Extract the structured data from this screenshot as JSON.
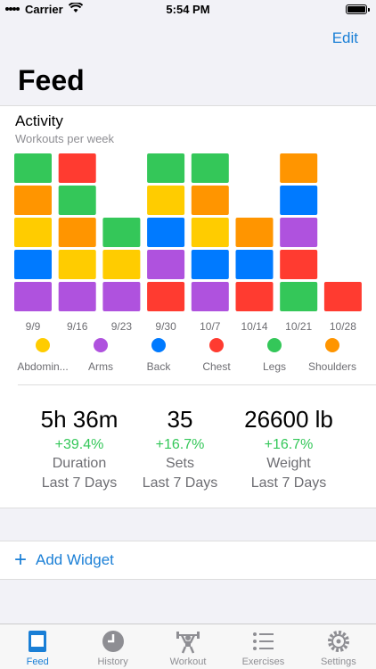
{
  "status": {
    "carrier": "Carrier",
    "time": "5:54 PM"
  },
  "nav": {
    "edit_label": "Edit",
    "title": "Feed"
  },
  "activity": {
    "title": "Activity",
    "subtitle": "Workouts per week"
  },
  "chart_data": {
    "type": "bar",
    "stacked": true,
    "categories": [
      "9/9",
      "9/16",
      "9/23",
      "9/30",
      "10/7",
      "10/14",
      "10/21",
      "10/28"
    ],
    "stacks": [
      [
        "Arms",
        "Back",
        "Abdominals",
        "Shoulders",
        "Legs"
      ],
      [
        "Arms",
        "Abdominals",
        "Shoulders",
        "Legs",
        "Chest"
      ],
      [
        "Arms",
        "Abdominals",
        "Legs"
      ],
      [
        "Chest",
        "Arms",
        "Back",
        "Abdominals",
        "Legs"
      ],
      [
        "Arms",
        "Back",
        "Abdominals",
        "Shoulders",
        "Legs"
      ],
      [
        "Chest",
        "Back",
        "Shoulders"
      ],
      [
        "Legs",
        "Chest",
        "Arms",
        "Back",
        "Shoulders"
      ],
      [
        "Chest"
      ]
    ],
    "legend": [
      {
        "name": "Abdomin...",
        "color": "#ffcc00"
      },
      {
        "name": "Arms",
        "color": "#af52de"
      },
      {
        "name": "Back",
        "color": "#007aff"
      },
      {
        "name": "Chest",
        "color": "#ff3b30"
      },
      {
        "name": "Legs",
        "color": "#34c759"
      },
      {
        "name": "Shoulders",
        "color": "#ff9500"
      }
    ],
    "colors": {
      "Abdominals": "#ffcc00",
      "Arms": "#af52de",
      "Back": "#007aff",
      "Chest": "#ff3b30",
      "Legs": "#34c759",
      "Shoulders": "#ff9500"
    }
  },
  "stats": [
    {
      "value": "5h 36m",
      "change": "+39.4%",
      "label": "Duration",
      "period": "Last 7 Days"
    },
    {
      "value": "35",
      "change": "+16.7%",
      "label": "Sets",
      "period": "Last 7 Days"
    },
    {
      "value": "26600 lb",
      "change": "+16.7%",
      "label": "Weight",
      "period": "Last 7 Days"
    }
  ],
  "add_widget": {
    "label": "Add Widget"
  },
  "tabs": [
    {
      "label": "Feed",
      "icon": "feed-icon"
    },
    {
      "label": "History",
      "icon": "clock-icon"
    },
    {
      "label": "Workout",
      "icon": "weightlifter-icon"
    },
    {
      "label": "Exercises",
      "icon": "list-icon"
    },
    {
      "label": "Settings",
      "icon": "gear-icon"
    }
  ],
  "colors": {
    "accent": "#1a7fd6",
    "positive": "#34c759"
  }
}
